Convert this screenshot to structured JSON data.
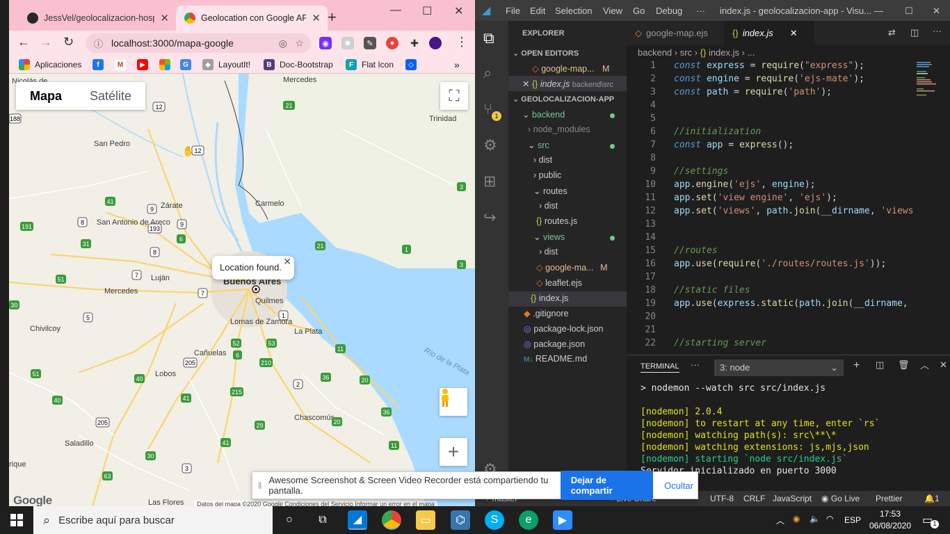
{
  "chrome": {
    "tabs": [
      {
        "title": "JessVel/geolocalizacion-hosp",
        "icon": "github-icon",
        "active": false
      },
      {
        "title": "Geolocation con Google API",
        "icon": "chrome-favicon-icon",
        "active": true
      }
    ],
    "new_tab": "+",
    "url": "localhost:3000/mapa-google",
    "bookmarks": [
      {
        "label": "Aplicaciones",
        "icon": "apps-grid-icon",
        "color": "#e94235"
      },
      {
        "label": "",
        "icon": "facebook-icon",
        "color": "#1877f2"
      },
      {
        "label": "",
        "icon": "gmail-icon",
        "color": "#d93025"
      },
      {
        "label": "",
        "icon": "youtube-icon",
        "color": "#ff0000"
      },
      {
        "label": "",
        "icon": "microsoft-icon",
        "color": "#f25022"
      },
      {
        "label": "",
        "icon": "translate-icon",
        "color": "#4285f4"
      },
      {
        "label": "LayoutIt!",
        "icon": "cube-icon",
        "color": "#5f6368"
      },
      {
        "label": "Doc-Bootstrap",
        "icon": "bootstrap-icon",
        "color": "#563d7c"
      },
      {
        "label": "Flat Icon",
        "icon": "flaticon-icon",
        "color": "#0fa3b1"
      },
      {
        "label": "",
        "icon": "dropbox-icon",
        "color": "#0061ff"
      }
    ]
  },
  "map": {
    "type_buttons": [
      "Mapa",
      "Satélite"
    ],
    "info_window": "Location found.",
    "logo": "Google",
    "attribution": "Datos del mapa ©2020 Google   Condiciones del Servicio   Informar un error en el mapa",
    "places": [
      "Nicolás de",
      "Mercedes",
      "Trinidad",
      "San Pedro",
      "Zárate",
      "Carmelo",
      "San Antonio de Areco",
      "Luján",
      "Mercedes",
      "Buenos Aires",
      "Quilmes",
      "Lomas de Zamora",
      "La Plata",
      "Chivilcoy",
      "Cañuelas",
      "Lobos",
      "Chascomús",
      "Saladillo",
      "Río de la Plata",
      "Las Flores",
      "rique"
    ],
    "routes": [
      "12",
      "21",
      "12",
      "188",
      "3",
      "41",
      "9",
      "8",
      "193",
      "9",
      "191",
      "31",
      "6",
      "8",
      "21",
      "1",
      "3",
      "7",
      "51",
      "7",
      "5",
      "30",
      "1",
      "52",
      "53",
      "11",
      "205",
      "6",
      "210",
      "51",
      "40",
      "2",
      "36",
      "20",
      "41",
      "215",
      "205",
      "29",
      "20",
      "36",
      "40",
      "41",
      "11",
      "30",
      "3",
      "63"
    ]
  },
  "vscode": {
    "menu": [
      "File",
      "Edit",
      "Selection",
      "View",
      "Go",
      "Debug",
      "···"
    ],
    "window_title": "index.js - geolocalizacion-app - Visu...",
    "explorer_title": "EXPLORER",
    "open_editors_title": "OPEN EDITORS",
    "open_editors": [
      {
        "name": "google-map...",
        "badge": "M"
      },
      {
        "name": "index.js",
        "path": "backend\\src"
      }
    ],
    "project_title": "GEOLOCALIZACION-APP",
    "tree": [
      {
        "name": "backend",
        "badge": "dot"
      },
      {
        "name": "node_modules"
      },
      {
        "name": "src",
        "badge": "dot"
      },
      {
        "name": "dist"
      },
      {
        "name": "public"
      },
      {
        "name": "routes"
      },
      {
        "name": "dist"
      },
      {
        "name": "routes.js"
      },
      {
        "name": "views",
        "badge": "dot"
      },
      {
        "name": "dist"
      },
      {
        "name": "google-ma...",
        "badge": "M"
      },
      {
        "name": "leaflet.ejs"
      },
      {
        "name": "index.js"
      },
      {
        "name": ".gitignore"
      },
      {
        "name": "package-lock.json"
      },
      {
        "name": "package.json"
      },
      {
        "name": "README.md"
      }
    ],
    "editor_tabs": [
      "google-map.ejs",
      "index.js"
    ],
    "breadcrumb": [
      "backend",
      "src",
      "index.js",
      "..."
    ],
    "code_lines": [
      "const express = require(\"express\");",
      "const engine = require('ejs-mate');",
      "const path = require('path');",
      "",
      "",
      "//initialization",
      "const app = express();",
      "",
      "//settings",
      "app.engine('ejs', engine);",
      "app.set('view engine', 'ejs');",
      "app.set('views', path.join(__dirname, 'views",
      "",
      "",
      "//routes",
      "app.use(require('./routes/routes.js'));",
      "",
      "//static files",
      "app.use(express.static(path.join(__dirname,",
      "",
      "",
      "//starting server"
    ],
    "terminal": {
      "title": "TERMINAL",
      "menu": "···",
      "selector": "3: node",
      "lines": [
        {
          "text": "> nodemon --watch src src/index.js",
          "color": "white"
        },
        {
          "text": "",
          "color": "white"
        },
        {
          "text": "[nodemon] 2.0.4",
          "color": "yellow"
        },
        {
          "text": "[nodemon] to restart at any time, enter `rs`",
          "color": "yellow"
        },
        {
          "text": "[nodemon] watching path(s): src\\**\\*",
          "color": "yellow"
        },
        {
          "text": "[nodemon] watching extensions: js,mjs,json",
          "color": "yellow"
        },
        {
          "text": "[nodemon] starting `node src/index.js`",
          "color": "green"
        },
        {
          "text": "Servidor inicializado en puerto 3000",
          "color": "white"
        }
      ]
    },
    "status": [
      "master",
      "Live Share",
      "UTF-8",
      "CRLF",
      "JavaScript",
      "Go Live",
      "Prettier",
      "1"
    ]
  },
  "share_banner": {
    "message": "Awesome Screenshot & Screen Video Recorder está compartiendo tu pantalla.",
    "stop_label": "Dejar de compartir",
    "hide_label": "Ocultar"
  },
  "taskbar": {
    "search_placeholder": "Escribe aquí para buscar",
    "language": "ESP",
    "time": "17:53",
    "date": "06/08/2020",
    "notifications": "1"
  }
}
